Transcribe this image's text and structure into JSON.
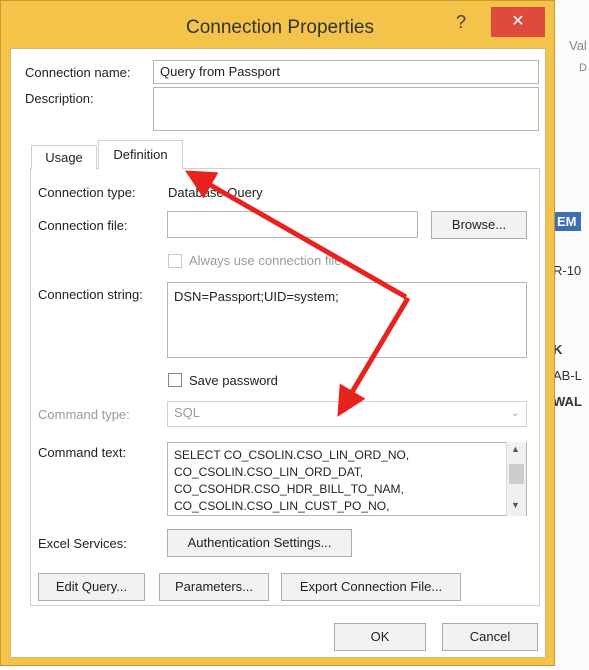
{
  "background": {
    "texts": [
      "Val",
      "D",
      "EM",
      "R-10",
      "K",
      "AB-L",
      "WAL"
    ]
  },
  "dialog": {
    "title": "Connection Properties",
    "help_label": "?",
    "close_label": "✕",
    "connection_name_label": "Connection name:",
    "connection_name_value": "Query from Passport",
    "description_label": "Description:",
    "description_value": "",
    "tabs": [
      {
        "label": "Usage",
        "selected": false
      },
      {
        "label": "Definition",
        "selected": true
      }
    ],
    "definition": {
      "connection_type_label": "Connection type:",
      "connection_type_value": "Database Query",
      "connection_file_label": "Connection file:",
      "connection_file_value": "",
      "browse_label": "Browse...",
      "always_use_label": "Always use connection file",
      "connection_string_label": "Connection string:",
      "connection_string_value": "DSN=Passport;UID=system;",
      "save_password_label": "Save password",
      "command_type_label": "Command type:",
      "command_type_value": "SQL",
      "command_text_label": "Command text:",
      "command_text_lines": [
        "SELECT CO_CSOLIN.CSO_LIN_ORD_NO,",
        "CO_CSOLIN.CSO_LIN_ORD_DAT,",
        "CO_CSOHDR.CSO_HDR_BILL_TO_NAM,",
        "CO_CSOLIN.CSO_LIN_CUST_PO_NO,"
      ],
      "excel_services_label": "Excel Services:",
      "auth_settings_label": "Authentication Settings...",
      "edit_query_label": "Edit Query...",
      "parameters_label": "Parameters...",
      "export_label": "Export Connection File..."
    },
    "ok_label": "OK",
    "cancel_label": "Cancel"
  },
  "annotation": {
    "arrow_color": "#e8221d"
  }
}
